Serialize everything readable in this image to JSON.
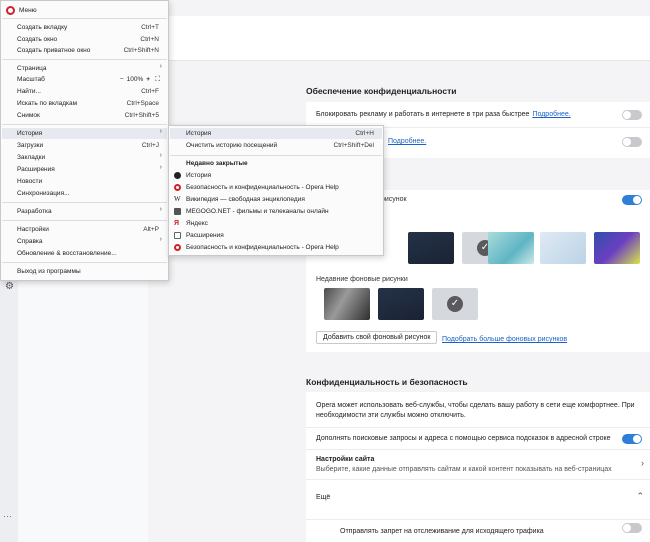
{
  "main_menu": {
    "header": "Меню",
    "items": [
      {
        "label": "Создать вкладку",
        "shortcut": "Ctrl+T"
      },
      {
        "label": "Создать окно",
        "shortcut": "Ctrl+N"
      },
      {
        "label": "Создать приватное окно",
        "shortcut": "Ctrl+Shift+N"
      },
      {
        "label": "Страница"
      },
      {
        "label": "Масштаб",
        "zoom": "100%"
      },
      {
        "label": "Найти...",
        "shortcut": "Ctrl+F"
      },
      {
        "label": "Искать по вкладкам",
        "shortcut": "Ctrl+Space"
      },
      {
        "label": "Снимок",
        "shortcut": "Ctrl+Shift+5"
      },
      {
        "label": "История"
      },
      {
        "label": "Загрузки",
        "shortcut": "Ctrl+J"
      },
      {
        "label": "Закладки"
      },
      {
        "label": "Расширения"
      },
      {
        "label": "Новости"
      },
      {
        "label": "Синхронизация..."
      },
      {
        "label": "Разработка"
      },
      {
        "label": "Настройки",
        "shortcut": "Alt+P"
      },
      {
        "label": "Справка"
      },
      {
        "label": "Обновление & восстановление..."
      },
      {
        "label": "Выход из программы"
      }
    ]
  },
  "history_menu": {
    "history_label": "История",
    "history_shortcut": "Ctrl+H",
    "clear_label": "Очистить историю посещений",
    "clear_shortcut": "Ctrl+Shift+Del",
    "recent_header": "Недавно закрытые",
    "recent": [
      {
        "label": "История",
        "icon": "clock-icon"
      },
      {
        "label": "Безопасность и конфиденциальность - Opera Help",
        "icon": "opera-icon"
      },
      {
        "label": "Википедия — свободная энциклопедия",
        "icon": "wikipedia-icon"
      },
      {
        "label": "MEGOGO.NET - фильмы и телеканалы онлайн",
        "icon": "megogo-icon"
      },
      {
        "label": "Яндекс",
        "icon": "yandex-icon"
      },
      {
        "label": "Расширения",
        "icon": "extensions-icon"
      },
      {
        "label": "Безопасность и конфиденциальность - Opera Help",
        "icon": "opera-icon"
      }
    ]
  },
  "settings": {
    "privacy_title": "Обеспечение конфиденциальности",
    "adblock_text": "Блокировать рекламу и работать в интернете в три раза быстрее",
    "more_link": "Подробнее.",
    "more_link2": "Подробнее.",
    "ghost_text": "рисунок",
    "recent_bg_title": "Недавние фоновые рисунки",
    "add_bg_button": "Добавить свой фоновый рисунок",
    "more_bg_link": "Подобрать больше фоновых рисунков",
    "security_title": "Конфиденциальность и безопасность",
    "security_desc": "Opera может использовать веб-службы, чтобы сделать вашу работу в сети еще комфортнее. При необходимости эти службы можно отключить.",
    "suggest_text": "Дополнять поисковые запросы и адреса с помощью сервиса подсказок в адресной строке",
    "site_settings_title": "Настройки сайта",
    "site_settings_desc": "Выберите, какие данные отправлять сайтам и какой контент показывать на веб-страницах",
    "more_label": "Ещё",
    "dnt_text": "Отправлять запрет на отслеживание для исходящего трафика"
  },
  "colors": {
    "accent": "#2f7fd9",
    "opera_red": "#d0202a"
  }
}
